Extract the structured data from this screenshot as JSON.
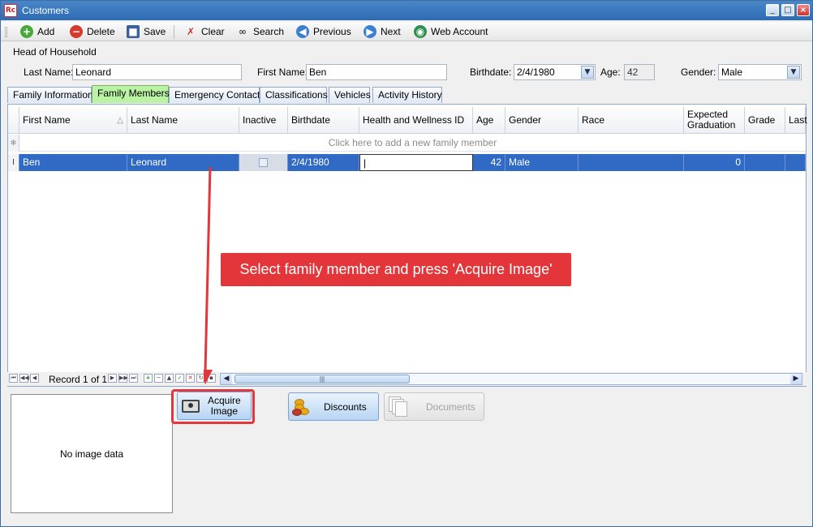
{
  "window": {
    "title": "Customers",
    "app_icon_text": "Rc"
  },
  "toolbar": {
    "items": [
      {
        "label": "Add",
        "icon": "plus-circle-icon"
      },
      {
        "label": "Delete",
        "icon": "minus-circle-icon"
      },
      {
        "label": "Save",
        "icon": "floppy-icon"
      },
      {
        "label": "Clear",
        "icon": "eraser-icon"
      },
      {
        "label": "Search",
        "icon": "binoculars-icon"
      },
      {
        "label": "Previous",
        "icon": "arrow-left-icon"
      },
      {
        "label": "Next",
        "icon": "arrow-right-icon"
      },
      {
        "label": "Web Account",
        "icon": "globe-icon"
      }
    ]
  },
  "head": {
    "section": "Head of Household",
    "last_name_label": "Last Name:",
    "last_name": "Leonard",
    "first_name_label": "First Name:",
    "first_name": "Ben",
    "birthdate_label": "Birthdate:",
    "birthdate": "2/4/1980",
    "age_label": "Age:",
    "age": "42",
    "gender_label": "Gender:",
    "gender": "Male"
  },
  "tabs": [
    "Family Information",
    "Family Members",
    "Emergency Contacts",
    "Classifications",
    "Vehicles",
    "Activity History"
  ],
  "grid": {
    "columns": [
      "First Name",
      "Last Name",
      "Inactive",
      "Birthdate",
      "Health and Wellness ID",
      "Age",
      "Gender",
      "Race",
      "Expected Graduation",
      "Grade",
      "Last"
    ],
    "new_row_text": "Click here to add a new family member",
    "row": {
      "first_name": "Ben",
      "last_name": "Leonard",
      "birthdate": "2/4/1980",
      "age": "42",
      "gender": "Male",
      "expected_graduation": "0"
    },
    "record_text": "Record 1 of 1"
  },
  "image_panel": {
    "text": "No image data"
  },
  "buttons": {
    "acquire_line1": "Acquire",
    "acquire_line2": "Image",
    "discounts": "Discounts",
    "documents": "Documents"
  },
  "callout": "Select family member and press 'Acquire Image'",
  "colors": {
    "highlight": "#e2363b",
    "selection": "#316ac5",
    "active_tab": "#b9f3a3"
  }
}
